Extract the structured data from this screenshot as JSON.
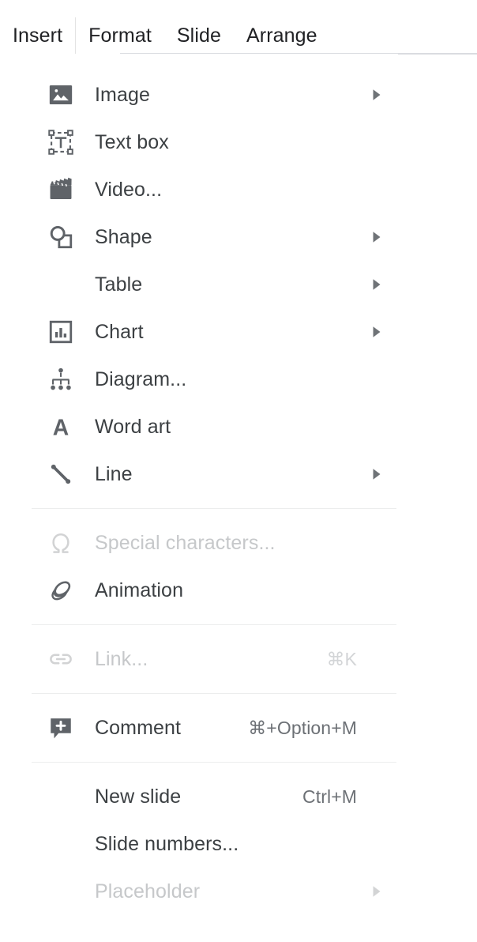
{
  "menubar": {
    "tabs": [
      {
        "label": "Insert",
        "active": true
      },
      {
        "label": "Format",
        "active": false
      },
      {
        "label": "Slide",
        "active": false
      },
      {
        "label": "Arrange",
        "active": false
      }
    ]
  },
  "colors": {
    "text": "#3c4043",
    "disabled_text": "#c6c8ca",
    "shortcut_text": "#6c7075",
    "icon": "#5f6368",
    "separator": "#eceded",
    "panel_background": "#ffffff",
    "menubar_underline": "#dadce0"
  },
  "menu": {
    "title": "Insert",
    "groups": [
      {
        "items": [
          {
            "label": "Image",
            "icon": "image-icon",
            "shortcut": "",
            "submenu": true,
            "disabled": false
          },
          {
            "label": "Text box",
            "icon": "textbox-icon",
            "shortcut": "",
            "submenu": false,
            "disabled": false
          },
          {
            "label": "Video...",
            "icon": "video-icon",
            "shortcut": "",
            "submenu": false,
            "disabled": false
          },
          {
            "label": "Shape",
            "icon": "shape-icon",
            "shortcut": "",
            "submenu": true,
            "disabled": false
          },
          {
            "label": "Table",
            "icon": "none",
            "shortcut": "",
            "submenu": true,
            "disabled": false
          },
          {
            "label": "Chart",
            "icon": "chart-icon",
            "shortcut": "",
            "submenu": true,
            "disabled": false
          },
          {
            "label": "Diagram...",
            "icon": "diagram-icon",
            "shortcut": "",
            "submenu": false,
            "disabled": false
          },
          {
            "label": "Word art",
            "icon": "wordart-icon",
            "shortcut": "",
            "submenu": false,
            "disabled": false
          },
          {
            "label": "Line",
            "icon": "line-icon",
            "shortcut": "",
            "submenu": true,
            "disabled": false
          }
        ]
      },
      {
        "items": [
          {
            "label": "Special characters...",
            "icon": "omega-icon",
            "shortcut": "",
            "submenu": false,
            "disabled": true
          },
          {
            "label": "Animation",
            "icon": "animation-icon",
            "shortcut": "",
            "submenu": false,
            "disabled": false
          }
        ]
      },
      {
        "items": [
          {
            "label": "Link...",
            "icon": "link-icon",
            "shortcut": "⌘K",
            "submenu": false,
            "disabled": true
          }
        ]
      },
      {
        "items": [
          {
            "label": "Comment",
            "icon": "comment-icon",
            "shortcut": "⌘+Option+M",
            "submenu": false,
            "disabled": false
          }
        ]
      },
      {
        "items": [
          {
            "label": "New slide",
            "icon": "none",
            "shortcut": "Ctrl+M",
            "submenu": false,
            "disabled": false
          },
          {
            "label": "Slide numbers...",
            "icon": "none",
            "shortcut": "",
            "submenu": false,
            "disabled": false
          },
          {
            "label": "Placeholder",
            "icon": "none",
            "shortcut": "",
            "submenu": true,
            "disabled": true
          }
        ]
      }
    ]
  }
}
